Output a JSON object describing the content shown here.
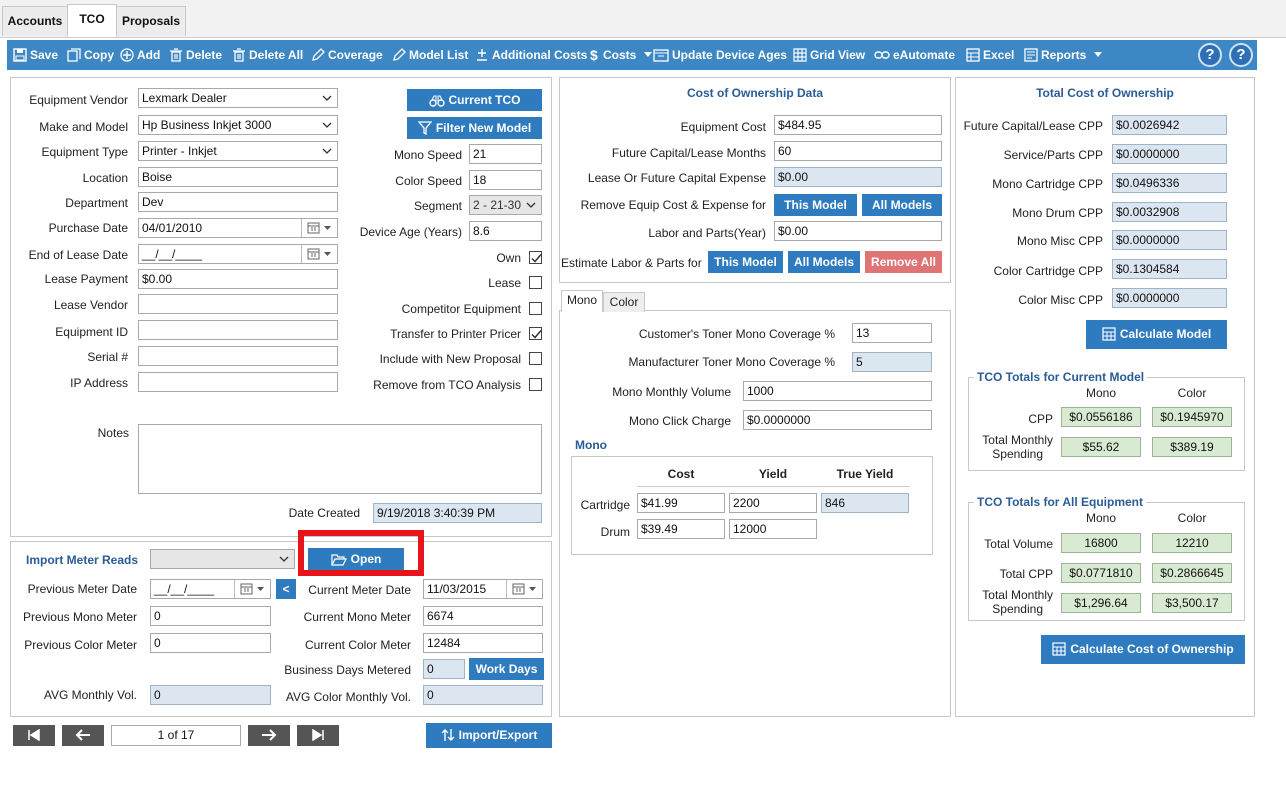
{
  "tabs": [
    "Accounts",
    "TCO",
    "Proposals"
  ],
  "toolbar": {
    "save": "Save",
    "copy": "Copy",
    "add": "Add",
    "delete": "Delete",
    "delete_all": "Delete All",
    "coverage": "Coverage",
    "model_list": "Model List",
    "additional_costs": "Additional Costs",
    "costs": "Costs",
    "update_device_ages": "Update Device Ages",
    "grid_view": "Grid View",
    "eautomate": "eAutomate",
    "excel": "Excel",
    "reports": "Reports",
    "help": "?"
  },
  "equipment": {
    "vendor_label": "Equipment Vendor",
    "vendor": "Lexmark Dealer",
    "make_model_label": "Make and Model",
    "make_model": "Hp Business Inkjet 3000",
    "type_label": "Equipment Type",
    "type": "Printer - Inkjet",
    "location_label": "Location",
    "location": "Boise",
    "department_label": "Department",
    "department": "Dev",
    "purchase_date_label": "Purchase Date",
    "purchase_date": "04/01/2010",
    "end_lease_label": "End of Lease Date",
    "end_lease": "__/__/____",
    "lease_payment_label": "Lease Payment",
    "lease_payment": "$0.00",
    "lease_vendor_label": "Lease Vendor",
    "lease_vendor": "",
    "equipment_id_label": "Equipment ID",
    "equipment_id": "",
    "serial_label": "Serial #",
    "serial": "",
    "ip_label": "IP Address",
    "ip": "",
    "notes_label": "Notes",
    "notes": "",
    "current_tco_btn": "Current TCO",
    "filter_model_btn": "Filter New Model",
    "mono_speed_label": "Mono Speed",
    "mono_speed": "21",
    "color_speed_label": "Color Speed",
    "color_speed": "18",
    "segment_label": "Segment",
    "segment": "2 - 21-30",
    "device_age_label": "Device Age (Years)",
    "device_age": "8.6",
    "own_label": "Own",
    "lease_label": "Lease",
    "competitor_label": "Competitor Equipment",
    "transfer_label": "Transfer to Printer Pricer",
    "include_label": "Include with New Proposal",
    "remove_label": "Remove from TCO Analysis",
    "date_created_label": "Date Created",
    "date_created": "9/19/2018 3:40:39 PM"
  },
  "meter": {
    "import_label": "Import Meter Reads",
    "open_btn": "Open",
    "prev_date_label": "Previous Meter Date",
    "prev_date": "__/__/____",
    "cur_date_label": "Current Meter Date",
    "cur_date": "11/03/2015",
    "prev_mono_label": "Previous Mono Meter",
    "prev_mono": "0",
    "cur_mono_label": "Current Mono Meter",
    "cur_mono": "6674",
    "prev_color_label": "Previous Color Meter",
    "prev_color": "0",
    "cur_color_label": "Current Color Meter",
    "cur_color": "12484",
    "bus_days_label": "Business Days Metered",
    "bus_days": "0",
    "work_days_btn": "Work Days",
    "avg_mono_label": "AVG Monthly Vol.",
    "avg_mono": "0",
    "avg_color_label": "AVG Color Monthly Vol.",
    "avg_color": "0",
    "copy_arrow": "<"
  },
  "nav": {
    "page": "1 of 17",
    "import_export": "Import/Export"
  },
  "cod": {
    "title": "Cost of Ownership Data",
    "equip_cost_label": "Equipment Cost",
    "equip_cost": "$484.95",
    "future_months_label": "Future Capital/Lease Months",
    "future_months": "60",
    "lease_expense_label": "Lease Or Future Capital Expense",
    "lease_expense": "$0.00",
    "remove_equip_label": "Remove Equip Cost & Expense for",
    "this_model": "This Model",
    "all_models": "All Models",
    "labor_label": "Labor and Parts(Year)",
    "labor": "$0.00",
    "estimate_label": "Estimate Labor & Parts for",
    "remove_all": "Remove All"
  },
  "mono": {
    "tab_mono": "Mono",
    "tab_color": "Color",
    "cust_cov_label": "Customer's Toner Mono Coverage %",
    "cust_cov": "13",
    "mfr_cov_label": "Manufacturer Toner Mono Coverage %",
    "mfr_cov": "5",
    "volume_label": "Mono Monthly Volume",
    "volume": "1000",
    "click_label": "Mono Click Charge",
    "click": "$0.0000000",
    "section": "Mono",
    "col_cost": "Cost",
    "col_yield": "Yield",
    "col_true_yield": "True Yield",
    "cartridge_label": "Cartridge",
    "cartridge_cost": "$41.99",
    "cartridge_yield": "2200",
    "cartridge_true": "846",
    "drum_label": "Drum",
    "drum_cost": "$39.49",
    "drum_yield": "12000"
  },
  "tco": {
    "title": "Total Cost of Ownership",
    "rows": [
      {
        "label": "Future Capital/Lease CPP",
        "value": "$0.0026942"
      },
      {
        "label": "Service/Parts CPP",
        "value": "$0.0000000"
      },
      {
        "label": "Mono Cartridge CPP",
        "value": "$0.0496336"
      },
      {
        "label": "Mono Drum CPP",
        "value": "$0.0032908"
      },
      {
        "label": "Mono Misc CPP",
        "value": "$0.0000000"
      },
      {
        "label": "Color Cartridge CPP",
        "value": "$0.1304584"
      },
      {
        "label": "Color Misc CPP",
        "value": "$0.0000000"
      }
    ],
    "calc_model": "Calculate Model",
    "current_legend": "TCO Totals for Current Model",
    "col_mono": "Mono",
    "col_color": "Color",
    "cpp_label": "CPP",
    "cpp_mono": "$0.0556186",
    "cpp_color": "$0.1945970",
    "tms_label_1": "Total Monthly",
    "tms_label_2": "Spending",
    "tms_mono": "$55.62",
    "tms_color": "$389.19",
    "all_legend": "TCO Totals for All Equipment",
    "total_vol_label": "Total Volume",
    "total_vol_mono": "16800",
    "total_vol_color": "12210",
    "total_cpp_label": "Total CPP",
    "total_cpp_mono": "$0.0771810",
    "total_cpp_color": "$0.2866645",
    "all_tms_mono": "$1,296.64",
    "all_tms_color": "$3,500.17",
    "calc_tco": "Calculate Cost of Ownership"
  },
  "colors": {
    "toolbar": "#3d87c4",
    "button": "#2f7bbf",
    "highlight": "#e8141b",
    "readonly": "#dce6f1",
    "total": "#d9ead3"
  }
}
